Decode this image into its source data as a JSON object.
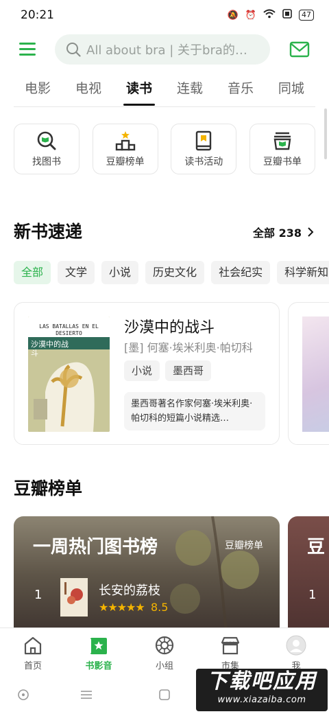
{
  "status_bar": {
    "time": "20:21",
    "battery": "47"
  },
  "search": {
    "placeholder": "All about bra | 关于bra的一…"
  },
  "tabs": [
    {
      "label": "电影",
      "active": false
    },
    {
      "label": "电视",
      "active": false
    },
    {
      "label": "读书",
      "active": true
    },
    {
      "label": "连载",
      "active": false
    },
    {
      "label": "音乐",
      "active": false
    },
    {
      "label": "同城",
      "active": false
    }
  ],
  "quick_entries": [
    {
      "label": "找图书",
      "icon": "find-book-icon"
    },
    {
      "label": "豆瓣榜单",
      "icon": "ranking-podium-icon"
    },
    {
      "label": "读书活动",
      "icon": "book-activity-icon"
    },
    {
      "label": "豆瓣书单",
      "icon": "booklist-basket-icon"
    }
  ],
  "new_books": {
    "title": "新书速递",
    "more": "全部 238",
    "chips": [
      "全部",
      "文学",
      "小说",
      "历史文化",
      "社会纪实",
      "科学新知"
    ],
    "active_chip": 0,
    "book": {
      "title": "沙漠中的战斗",
      "author": "[墨] 何塞·埃米利奥·帕切科",
      "tags": [
        "小说",
        "墨西哥"
      ],
      "description": "墨西哥著名作家何塞·埃米利奥·帕切科的短篇小说精选…",
      "cover_text_top": "LAS BATALLAS EN EL DESIERTO",
      "cover_title": "沙漠中的战斗"
    }
  },
  "rankings": {
    "title": "豆瓣榜单",
    "card": {
      "title": "一周热门图书榜",
      "source": "豆瓣榜单",
      "rank": "1",
      "book": "长安的荔枝",
      "stars": "★★★★★",
      "score": "8.5",
      "rating": 0.85
    },
    "card2": {
      "title": "豆",
      "rank": "1"
    }
  },
  "bottom_nav": [
    {
      "label": "首页",
      "icon": "home-icon",
      "active": false
    },
    {
      "label": "书影音",
      "icon": "star-ticket-icon",
      "active": true
    },
    {
      "label": "小组",
      "icon": "group-icon",
      "active": false
    },
    {
      "label": "市集",
      "icon": "market-icon",
      "active": false
    },
    {
      "label": "我",
      "icon": "avatar-icon",
      "active": false
    }
  ],
  "watermark": {
    "main": "下载吧应用",
    "url": "www.xiazaiba.com"
  },
  "colors": {
    "brand_green": "#2bb24c",
    "star": "#f4b400"
  }
}
